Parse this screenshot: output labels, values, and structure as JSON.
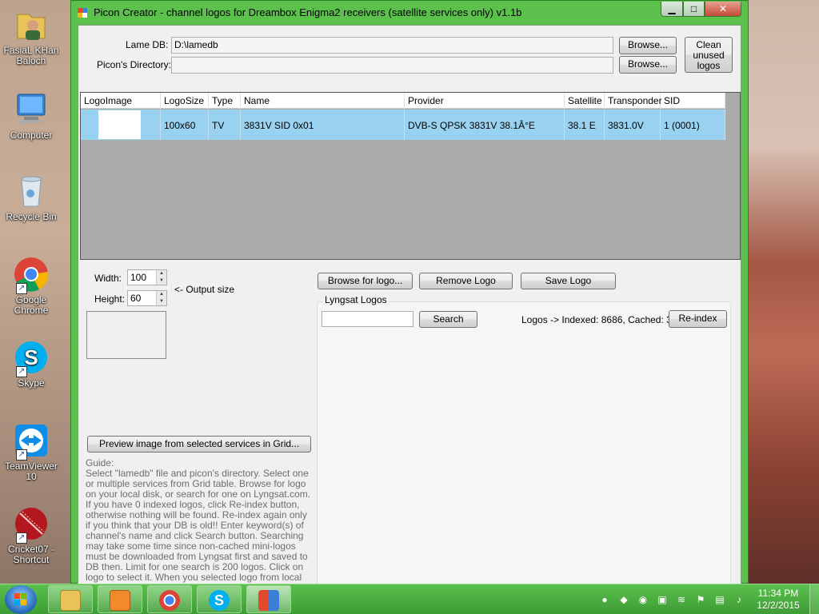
{
  "window": {
    "title": "Picon Creator - channel logos for Dreambox Enigma2 receivers (satellite services only) v1.1b",
    "min_glyph": "▁",
    "max_glyph": "□",
    "close_glyph": "✕"
  },
  "form": {
    "lamedb_label": "Lame DB:",
    "lamedb_value": "D:\\lamedb",
    "picon_dir_label": "Picon's Directory:",
    "picon_dir_value": "",
    "browse1_label": "Browse...",
    "browse2_label": "Browse...",
    "clean_label": "Clean unused logos"
  },
  "grid": {
    "columns": [
      "LogoImage",
      "LogoSize",
      "Type",
      "Name",
      "Provider",
      "Satellite",
      "Transponder",
      "SID"
    ],
    "rows": [
      {
        "logo_size": "100x60",
        "type": "TV",
        "name": "3831V SID 0x01",
        "provider": "DVB-S QPSK 3831V 38.1Â°E",
        "satellite": "38.1 E",
        "transponder": "3831.0V",
        "sid": "1 (0001)"
      }
    ]
  },
  "output": {
    "width_label": "Width:",
    "width_value": "100",
    "height_label": "Height:",
    "height_value": "60",
    "hint": "<- Output size",
    "preview_button": "Preview image from selected services in Grid..."
  },
  "logo_actions": {
    "browse_logo": "Browse for logo...",
    "remove_logo": "Remove Logo",
    "save_logo": "Save Logo"
  },
  "lyngsat": {
    "group_title": "Lyngsat Logos",
    "search_value": "",
    "search_button": "Search",
    "status": "Logos -> Indexed: 8686, Cached: 30",
    "reindex_button": "Re-index"
  },
  "guide": {
    "title": "Guide:",
    "text": "Select \"lamedb\" file and picon's directory. Select one or multiple services from Grid table. Browse for logo on your local disk, or search for one on Lyngsat.com. If you have 0 indexed logos, click Re-index button, otherwise nothing will be found. Re-index again only if you think that your DB is old!! Enter keyword(s) of channel's name and click Search button. Searching may take some time since non-cached mini-logos must be downloaded from Lyngsat first and saved to DB then. Limit for one search is 200 logos. Click on logo to select it. When you selected logo from local disk or searched for one online, click the Save Logo button."
  },
  "desktop": {
    "icons": [
      {
        "label": "FasiaL KHan Baloch",
        "icon": "user-folder-icon"
      },
      {
        "label": "Computer",
        "icon": "computer-icon"
      },
      {
        "label": "Recycle Bin",
        "icon": "recycle-bin-icon"
      },
      {
        "label": "Google Chrome",
        "icon": "chrome-icon"
      },
      {
        "label": "Skype",
        "icon": "skype-icon"
      },
      {
        "label": "TeamViewer 10",
        "icon": "teamviewer-icon"
      },
      {
        "label": "Cricket07 - Shortcut",
        "icon": "cricket-ball-icon"
      }
    ]
  },
  "taskbar": {
    "apps": [
      "explorer-icon",
      "media-player-icon",
      "chrome-icon",
      "skype-icon",
      "picon-creator-icon"
    ],
    "time": "11:34 PM",
    "date": "12/2/2015"
  },
  "colors": {
    "window_frame": "#5cc04d",
    "grid_selected_row": "#99d1f1",
    "grid_background": "#ababab",
    "taskbar": "#3e9c34"
  }
}
